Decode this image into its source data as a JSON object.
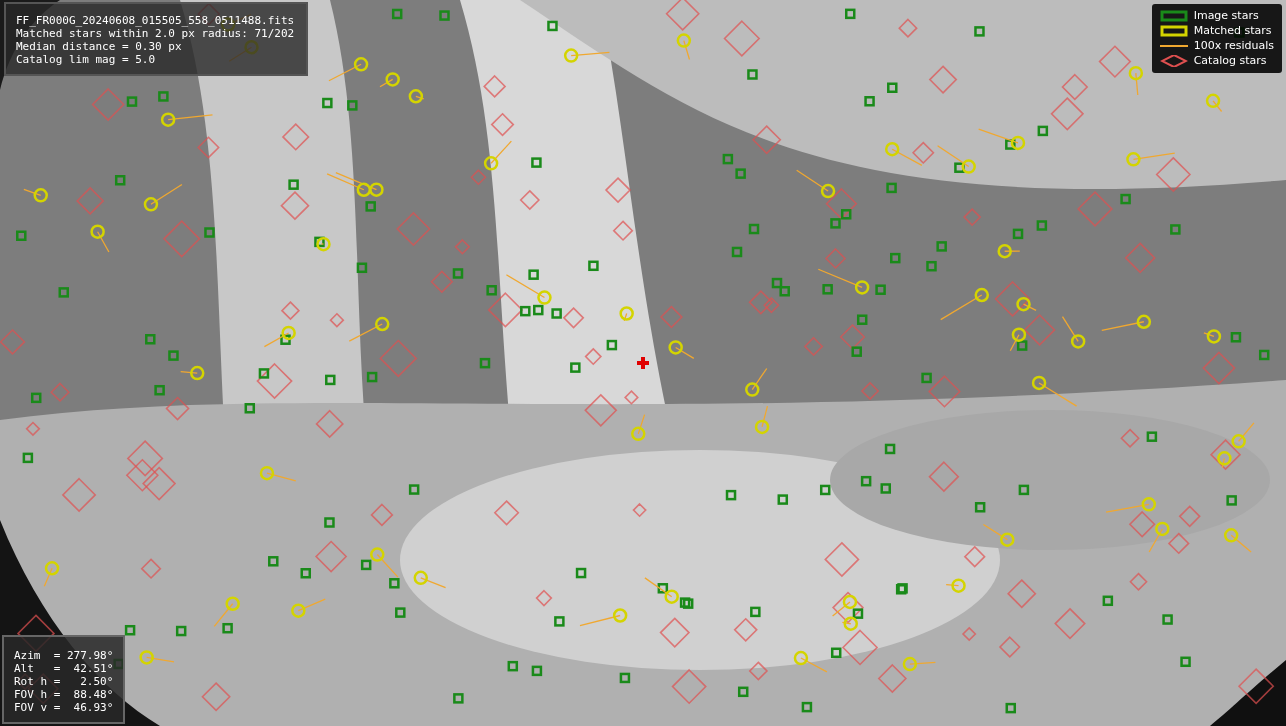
{
  "info_box": {
    "lines": [
      "FF_FR000G_20240608_015505_558_0511488.fits",
      "Matched stars within 2.0 px radius: 71/202",
      "Median distance = 0.30 px",
      "Catalog lim mag = 5.0"
    ]
  },
  "legend": [
    {
      "kind": "square",
      "label": "Image stars",
      "color": "#1a8a1a"
    },
    {
      "kind": "circle",
      "label": "Matched stars",
      "color": "#d4d400"
    },
    {
      "kind": "line",
      "label": "100x residuals",
      "color": "#f0a830"
    },
    {
      "kind": "diamond",
      "label": "Catalog stars",
      "color": "#e05050"
    }
  ],
  "pointing_box": {
    "lines": [
      "Azim  = 277.98°",
      "Alt   =  42.51°",
      "Rot h =   2.50°",
      "FOV h =  88.48°",
      "FOV v =  46.93°"
    ]
  }
}
